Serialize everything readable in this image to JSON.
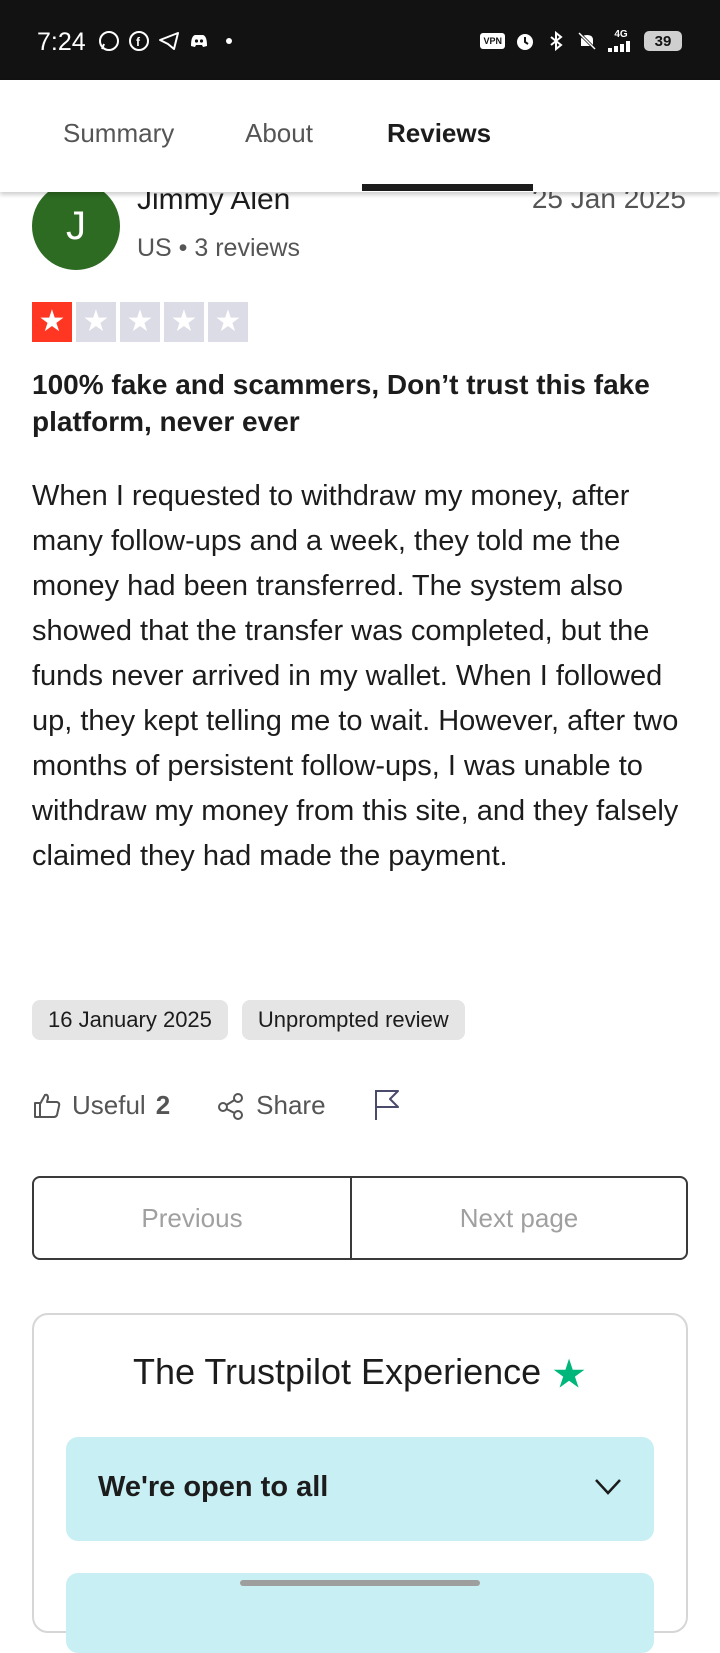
{
  "status_bar": {
    "time": "7:24",
    "left_icons": [
      "whatsapp-icon",
      "facebook-icon",
      "telegram-icon",
      "discord-icon",
      "dot-icon"
    ],
    "right_icons": [
      "vpn-icon",
      "alarm-icon",
      "bluetooth-icon",
      "mute-icon",
      "signal-icon"
    ],
    "vpn_label": "VPN",
    "network_label": "4G",
    "battery": "39"
  },
  "tabs": {
    "items": [
      {
        "label": "Summary",
        "active": false
      },
      {
        "label": "About",
        "active": false
      },
      {
        "label": "Reviews",
        "active": true
      }
    ]
  },
  "review": {
    "avatar_initial": "J",
    "avatar_color": "#2d6a22",
    "name": "Jimmy Alen",
    "meta": "US • 3 reviews",
    "date": "25 Jan 2025",
    "rating": 1,
    "max_rating": 5,
    "title": "100% fake and scammers, Don’t trust this fake platform, never ever",
    "body": "When I requested to withdraw my money, after many follow-ups and a week, they told me the money had been transferred. The system also showed that the transfer was completed, but the funds never arrived in my wallet. When I followed up, they kept telling me to wait. However, after two months of persistent follow-ups, I was unable to withdraw my money from this site, and they falsely claimed they had made the payment.",
    "experience_date": "16 January 2025",
    "review_type": "Unprompted review",
    "useful_label": "Useful",
    "useful_count": "2",
    "share_label": "Share"
  },
  "pagination": {
    "previous": "Previous",
    "next": "Next page"
  },
  "trustpilot_experience": {
    "title": "The Trustpilot Experience",
    "accordion_item": "We're open to all"
  },
  "colors": {
    "star_filled": "#ff3722",
    "star_empty": "#dcdce6",
    "accordion_bg": "#c8eff3",
    "brand_green": "#00b67a"
  }
}
